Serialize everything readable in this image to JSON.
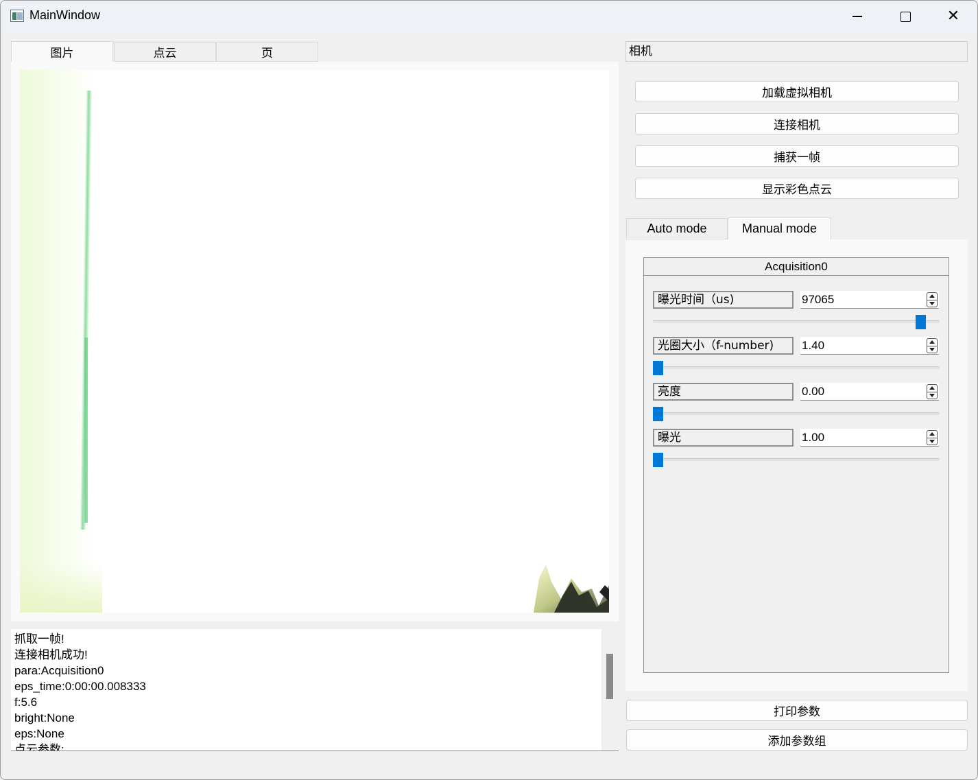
{
  "window": {
    "title": "MainWindow"
  },
  "left_tabs": [
    "图片",
    "点云",
    "页"
  ],
  "log": {
    "lines": [
      "抓取一帧!",
      "连接相机成功!",
      "para:Acquisition0",
      "eps_time:0:00:00.008333",
      "f:5.6",
      "bright:None",
      "eps:None",
      "点云参数:"
    ]
  },
  "camera": {
    "header": "相机",
    "buttons": [
      "加载虚拟相机",
      "连接相机",
      "捕获一帧",
      "显示彩色点云"
    ]
  },
  "mode_tabs": [
    "Auto mode",
    "Manual mode"
  ],
  "group": {
    "title": "Acquisition0",
    "params": [
      {
        "label": "曝光时间（us)",
        "value": "97065",
        "slider_fraction": 0.95
      },
      {
        "label": "光圈大小（f-number)",
        "value": "1.40",
        "slider_fraction": 0.0
      },
      {
        "label": "亮度",
        "value": "0.00",
        "slider_fraction": 0.0
      },
      {
        "label": "曝光",
        "value": "1.00",
        "slider_fraction": 0.0
      }
    ]
  },
  "bottom_buttons": [
    "打印参数",
    "添加参数组"
  ],
  "colors": {
    "accent": "#0078d7",
    "scrollbar_thumb": "#8a8a8a"
  },
  "icons": [
    "app-icon",
    "minimize-icon",
    "maximize-icon",
    "close-icon",
    "spin-up-icon",
    "spin-down-icon"
  ]
}
